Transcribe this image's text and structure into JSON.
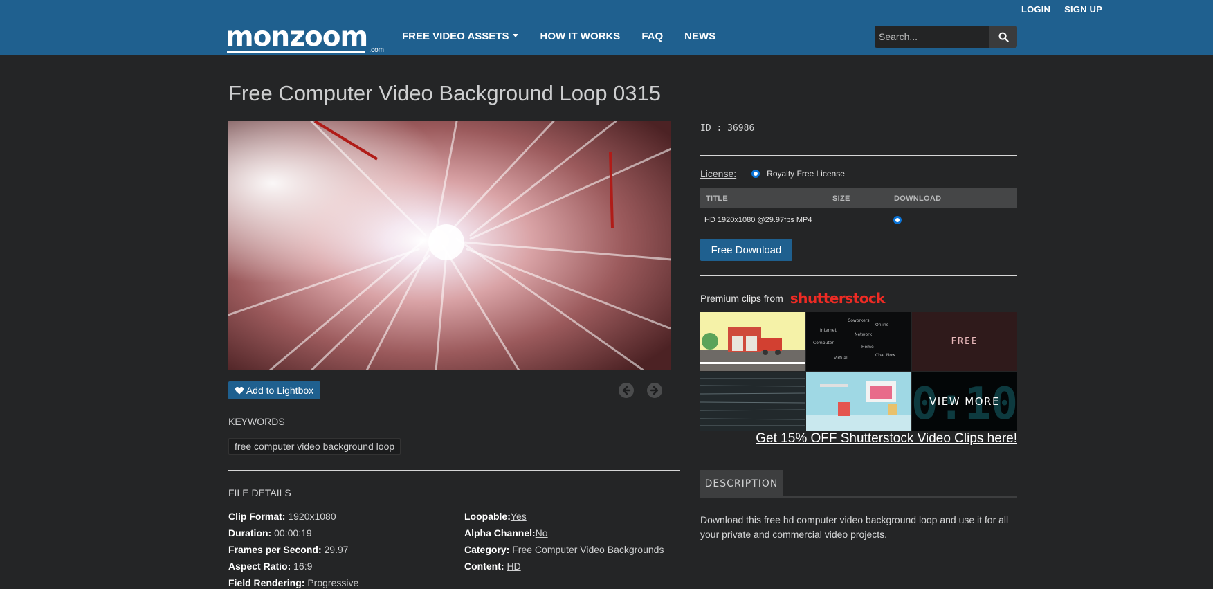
{
  "header": {
    "top_links": {
      "login": "LOGIN",
      "signup": "SIGN UP"
    },
    "logo": {
      "text": "monzoom",
      "suffix": ".com"
    },
    "nav": [
      {
        "label": "FREE VIDEO ASSETS",
        "has_dropdown": true
      },
      {
        "label": "HOW IT WORKS"
      },
      {
        "label": "FAQ"
      },
      {
        "label": "NEWS"
      }
    ],
    "search": {
      "placeholder": "Search...",
      "icon": "search-icon"
    }
  },
  "page_title": "Free Computer Video Background Loop 0315",
  "video": {
    "icon_prev": "arrow-left-icon",
    "icon_next": "arrow-right-icon"
  },
  "lightbox_button": {
    "label": "Add to Lightbox",
    "icon": "heart-icon"
  },
  "keywords": {
    "title": "KEYWORDS",
    "tags": [
      "free computer video background loop"
    ]
  },
  "file_details": {
    "title": "FILE DETAILS",
    "left": [
      {
        "label": "Clip Format:",
        "value": "1920x1080"
      },
      {
        "label": "Duration:",
        "value": "00:00:19"
      },
      {
        "label": "Frames per Second:",
        "value": "29.97"
      },
      {
        "label": "Aspect Ratio:",
        "value": "16:9"
      },
      {
        "label": "Field Rendering:",
        "value": "Progressive"
      }
    ],
    "right": [
      {
        "label": "Loopable:",
        "value": "Yes"
      },
      {
        "label": "Alpha Channel:",
        "value": "No"
      },
      {
        "label": "Category:",
        "value": "Free Computer Video Backgrounds"
      },
      {
        "label": "Content:",
        "value": "HD"
      }
    ]
  },
  "sidebar": {
    "id_line": "ID : 36986",
    "license": {
      "label": "License:",
      "value": "Royalty Free License"
    },
    "table": {
      "headers": {
        "title": "TITLE",
        "size": "SIZE",
        "download": "DOWNLOAD"
      },
      "rows": [
        {
          "title": "HD 1920x1080 @29.97fps MP4",
          "size": ""
        }
      ]
    },
    "free_download": "Free Download",
    "premium": {
      "text": "Premium clips from",
      "brand": "shutterstock"
    },
    "thumbs": {
      "free_label": "FREE",
      "view_more": "VIEW MORE",
      "digital_clock": "0:10"
    },
    "promo_link": "Get 15% OFF Shutterstock Video Clips here!",
    "description": {
      "tab": "DESCRIPTION",
      "text": "Download this free hd computer video background loop and use it for all your private and commercial video projects."
    }
  },
  "colors": {
    "header_bg": "#1f608f",
    "page_bg": "#242526",
    "accent": "#1f608f",
    "shutterstock_red": "#ee2b24"
  }
}
